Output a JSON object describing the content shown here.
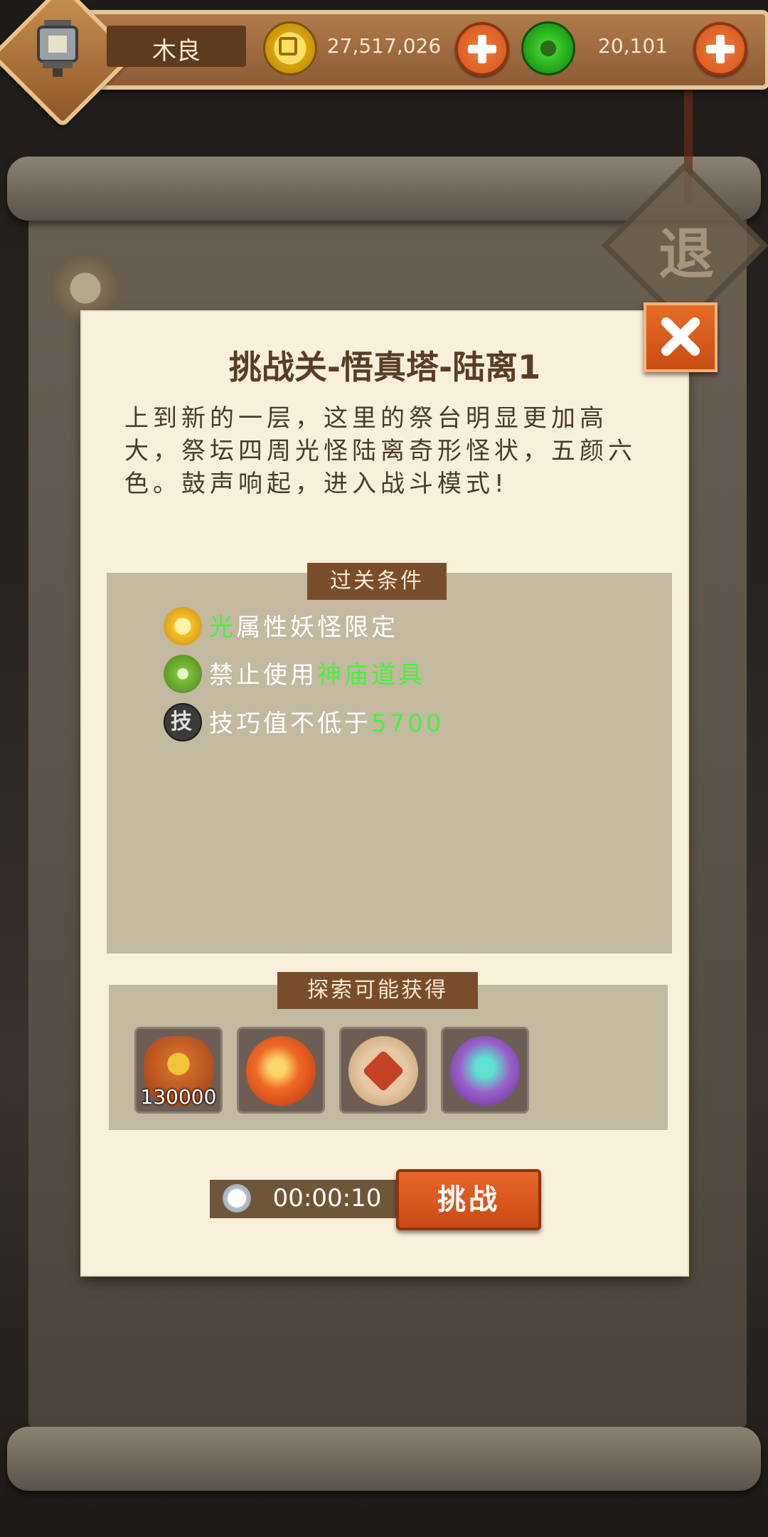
{
  "player": {
    "name": "木良",
    "gold": "27,517,026",
    "jade": "20,101"
  },
  "background": {
    "retreat_label": "退"
  },
  "dialog": {
    "title": "挑战关-悟真塔-陆离1",
    "description": "上到新的一层，这里的祭台明显更加高大，祭坛四周光怪陆离奇形怪状，五颜六色。鼓声响起，进入战斗模式!",
    "conditions_header": "过关条件",
    "conditions": [
      {
        "icon": "light-element-icon",
        "highlight": "光",
        "text": "属性妖怪限定"
      },
      {
        "icon": "leaf-item-icon",
        "prefix": "禁止使用",
        "highlight": "神庙道具"
      },
      {
        "icon": "skill-icon",
        "icon_text": "技",
        "prefix": "技巧值不低于",
        "highlight": "5700"
      }
    ],
    "rewards_header": "探索可能获得",
    "rewards": [
      {
        "icon": "gold-bag-icon",
        "count": "130000"
      },
      {
        "icon": "fire-stone-orb-icon"
      },
      {
        "icon": "strength-rune-orb-icon"
      },
      {
        "icon": "spirit-chest-orb-icon"
      }
    ],
    "timer": "00:00:10",
    "challenge_label": "挑战"
  },
  "colors": {
    "highlight": "#4cef3e",
    "button": "#d9561c",
    "panel": "#c3b9a1",
    "parchment": "#f8f0da"
  }
}
